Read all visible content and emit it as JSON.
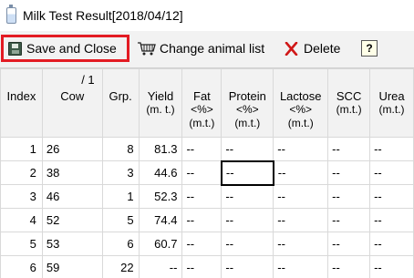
{
  "window": {
    "title": "Milk Test Result[2018/04/12]"
  },
  "toolbar": {
    "save_close": "Save and Close",
    "change_animal": "Change animal list",
    "delete": "Delete",
    "help": "?"
  },
  "table": {
    "headers": {
      "index": "Index",
      "cow_count": "/ 1",
      "cow": "Cow",
      "grp": "Grp.",
      "yield": "Yield",
      "yield_unit": "(m. t.)",
      "fat": "Fat",
      "fat_unit": "<%>",
      "fat_unit2": "(m.t.)",
      "protein": "Protein",
      "protein_unit": "<%>",
      "protein_unit2": "(m.t.)",
      "lactose": "Lactose",
      "lactose_unit": "<%>",
      "lactose_unit2": "(m.t.)",
      "scc": "SCC",
      "scc_unit": "(m.t.)",
      "urea": "Urea",
      "urea_unit": "(m.t.)"
    },
    "rows": [
      {
        "index": "1",
        "cow": "26",
        "grp": "8",
        "yield": "81.3",
        "fat": "--",
        "protein": "--",
        "lactose": "--",
        "scc": "--",
        "urea": "--"
      },
      {
        "index": "2",
        "cow": "38",
        "grp": "3",
        "yield": "44.6",
        "fat": "--",
        "protein": "--",
        "lactose": "--",
        "scc": "--",
        "urea": "--"
      },
      {
        "index": "3",
        "cow": "46",
        "grp": "1",
        "yield": "52.3",
        "fat": "--",
        "protein": "--",
        "lactose": "--",
        "scc": "--",
        "urea": "--"
      },
      {
        "index": "4",
        "cow": "52",
        "grp": "5",
        "yield": "74.4",
        "fat": "--",
        "protein": "--",
        "lactose": "--",
        "scc": "--",
        "urea": "--"
      },
      {
        "index": "5",
        "cow": "53",
        "grp": "6",
        "yield": "60.7",
        "fat": "--",
        "protein": "--",
        "lactose": "--",
        "scc": "--",
        "urea": "--"
      },
      {
        "index": "6",
        "cow": "59",
        "grp": "22",
        "yield": "--",
        "fat": "--",
        "protein": "--",
        "lactose": "--",
        "scc": "--",
        "urea": "--"
      }
    ]
  },
  "colors": {
    "highlight_border": "#e31b23",
    "header_bg": "#f2f2f2"
  }
}
